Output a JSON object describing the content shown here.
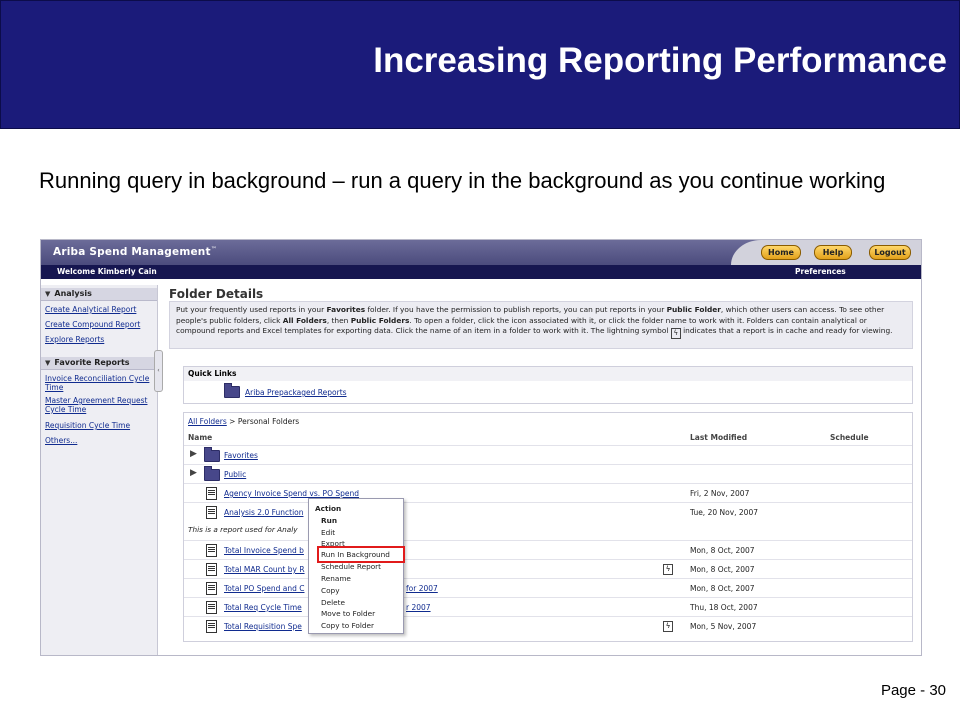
{
  "slide": {
    "title": "Increasing Reporting Performance",
    "subtitle": "Running query in background – run a query in the background as you continue working",
    "page_number": "Page - 30"
  },
  "app": {
    "logo": "Ariba Spend Management",
    "logo_sup_1": "®",
    "logo_tm": "™",
    "buttons": {
      "home": "Home",
      "help": "Help",
      "logout": "Logout"
    },
    "welcome": "Welcome Kimberly Cain",
    "preferences": "Preferences"
  },
  "sidebar": {
    "analysis_header": "Analysis",
    "analysis_items": [
      "Create Analytical Report",
      "Create Compound Report",
      "Explore Reports"
    ],
    "favorites_header": "Favorite Reports",
    "favorite_items": [
      "Invoice Reconciliation Cycle Time",
      "Master Agreement Request Cycle Time",
      "Requisition Cycle Time",
      "Others..."
    ]
  },
  "main": {
    "title": "Folder Details",
    "info_text_1": "Put your frequently used reports in your ",
    "info_fav": "Favorites",
    "info_text_2": " folder. If you have the permission to publish reports, you can put reports in your ",
    "info_pub": "Public Folder",
    "info_text_3": ", which other users can access. To see other people's public folders, click ",
    "info_all": "All Folders",
    "info_text_4": ", then ",
    "info_pubf": "Public Folders",
    "info_text_5": ". To open a folder, click the icon associated with it, or click the folder name to work with it. Folders can contain analytical or compound reports and Excel templates for exporting data. Click the name of an item in a folder to work with it. The lightning symbol ",
    "info_text_6": " indicates that a report is in cache and ready for viewing.",
    "quick_links_header": "Quick Links",
    "quick_link": "Ariba Prepackaged Reports",
    "breadcrumb_all": "All Folders",
    "breadcrumb_sep": ">",
    "breadcrumb_current": "Personal Folders",
    "columns": {
      "name": "Name",
      "last_modified": "Last Modified",
      "schedule": "Schedule"
    },
    "rows": [
      {
        "name": "Favorites",
        "date": ""
      },
      {
        "name": "Public",
        "date": ""
      },
      {
        "name": "Agency Invoice Spend vs. PO Spend",
        "date": "Fri, 2 Nov, 2007"
      },
      {
        "name": "Analysis 2.0 Function",
        "date": "Tue, 20 Nov, 2007"
      },
      {
        "name": "Total Invoice Spend b",
        "date": "Mon, 8 Oct, 2007"
      },
      {
        "name": "Total MAR Count by R",
        "date": "Mon, 8 Oct, 2007"
      },
      {
        "name": "Total PO Spend and C",
        "name_tail": "for 2007",
        "date": "Mon, 8 Oct, 2007"
      },
      {
        "name": "Total Req Cycle Time",
        "name_tail": "r 2007",
        "date": "Thu, 18 Oct, 2007"
      },
      {
        "name": "Total Requisition Spe",
        "date": "Mon, 5 Nov, 2007"
      }
    ],
    "row_note": "This is a report used for Analy"
  },
  "context_menu": {
    "header": "Action",
    "items": [
      "Run",
      "Edit",
      "Export",
      "Run In Background",
      "Schedule Report",
      "Rename",
      "Copy",
      "Delete",
      "Move to Folder",
      "Copy to Folder"
    ]
  },
  "colors": {
    "header_navy": "#1b1b7a",
    "highlight_red": "#e11b1b",
    "button_gold": "#e2a11b"
  }
}
